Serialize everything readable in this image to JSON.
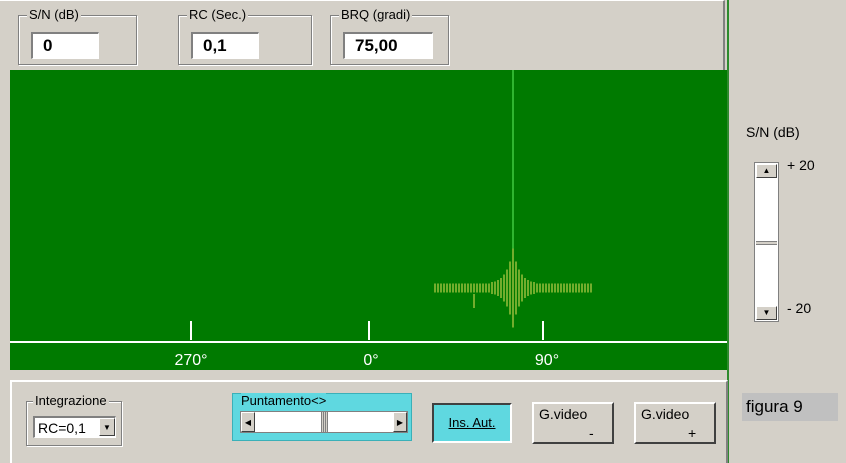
{
  "top": {
    "sn_label": "S/N (dB)",
    "sn_value": "0",
    "rc_label": "RC (Sec.)",
    "rc_value": "0,1",
    "brq_label": "BRQ (gradi)",
    "brq_value": "75,00"
  },
  "display": {
    "ticks": [
      "270°",
      "0°",
      "90°"
    ]
  },
  "right": {
    "sn_label": "S/N (dB)",
    "max_label": "+ 20",
    "min_label": "- 20",
    "up_icon": "triangle-up-icon",
    "down_icon": "triangle-down-icon"
  },
  "bottom": {
    "integrazione_label": "Integrazione",
    "integrazione_value": "RC=0,1",
    "puntamento_label": "Puntamento<>",
    "ins_aut_label": "Ins. Aut.",
    "gvideo_minus_label": "G.video",
    "gvideo_minus_sign": "-",
    "gvideo_plus_label": "G.video",
    "gvideo_plus_sign": "+"
  },
  "figure_label": "figura 9",
  "colors": {
    "screen": "#007a00",
    "trace": "#e6e05a",
    "cursor": "#5ff05f",
    "highlight": "#5fd8e0"
  }
}
